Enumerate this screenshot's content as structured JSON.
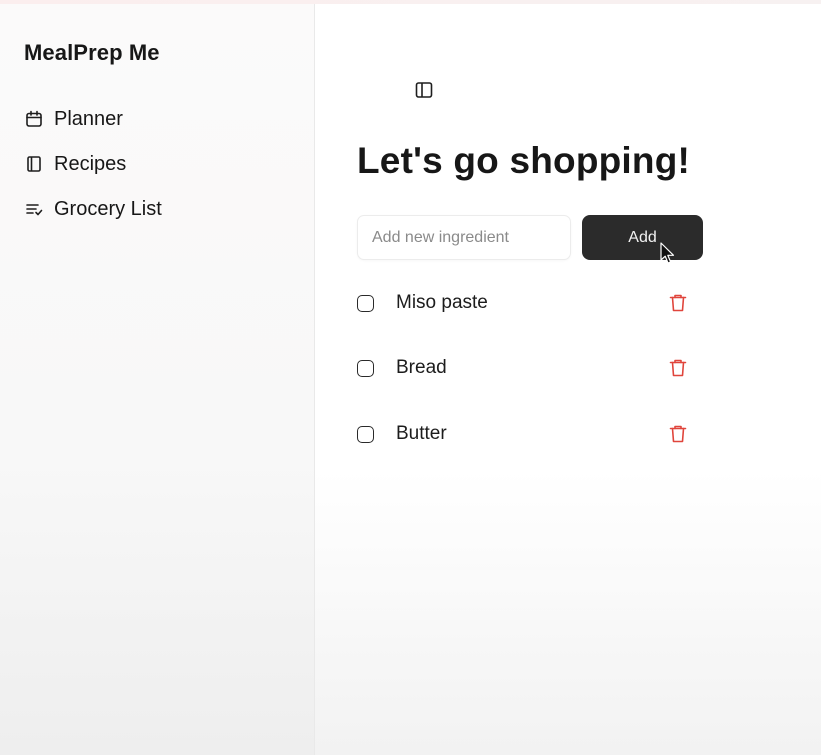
{
  "app": {
    "brand": "MealPrep Me"
  },
  "sidebar": {
    "items": [
      {
        "label": "Planner",
        "icon": "calendar-icon"
      },
      {
        "label": "Recipes",
        "icon": "book-icon"
      },
      {
        "label": "Grocery List",
        "icon": "list-check-icon"
      }
    ]
  },
  "header": {
    "toggle_icon": "sidebar-toggle-icon"
  },
  "main": {
    "title": "Let's go shopping!",
    "input": {
      "placeholder": "Add new ingredient",
      "value": ""
    },
    "add_label": "Add",
    "items": [
      {
        "label": "Miso paste",
        "checked": false
      },
      {
        "label": "Bread",
        "checked": false
      },
      {
        "label": "Butter",
        "checked": false
      }
    ]
  },
  "colors": {
    "accent_button": "#2b2b2b",
    "delete_icon": "#e0453c",
    "text": "#171717"
  }
}
